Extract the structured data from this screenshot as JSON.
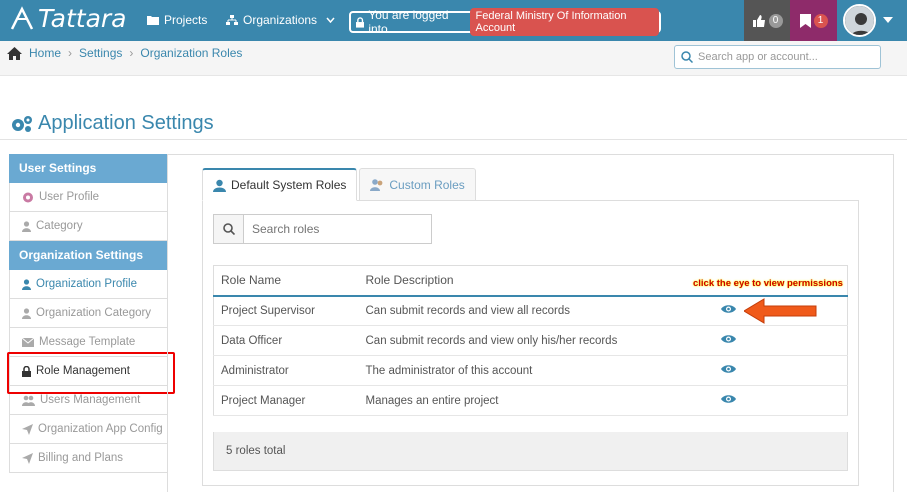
{
  "header": {
    "app_name": "Tattara",
    "nav": {
      "projects": "Projects",
      "organizations": "Organizations"
    },
    "login_prefix": "You are logged into",
    "account_name": "Federal Ministry Of Information Account",
    "likes_count": "0",
    "bookmarks_count": "1"
  },
  "breadcrumb": {
    "home": "Home",
    "settings": "Settings",
    "current": "Organization Roles"
  },
  "search_app": {
    "placeholder": "Search app or account..."
  },
  "page": {
    "title": "Application Settings"
  },
  "sidebar": {
    "user_settings": "User Settings",
    "user_profile": "User Profile",
    "category": "Category",
    "org_settings": "Organization Settings",
    "org_profile": "Organization Profile",
    "org_category": "Organization Category",
    "message_template": "Message Template",
    "role_management": "Role Management",
    "users_management": "Users Management",
    "org_app_config": "Organization App Config",
    "billing": "Billing and Plans"
  },
  "tabs": {
    "default_roles": "Default System Roles",
    "custom_roles": "Custom Roles"
  },
  "roles_search": {
    "placeholder": "Search roles"
  },
  "table": {
    "col_name": "Role Name",
    "col_description": "Role Description",
    "rows": [
      {
        "name": "Project Supervisor",
        "description": "Can submit records and view all records"
      },
      {
        "name": "Data Officer",
        "description": "Can submit records and view only his/her records"
      },
      {
        "name": "Administrator",
        "description": "The administrator of this account"
      },
      {
        "name": "Project Manager",
        "description": "Manages an entire project"
      }
    ],
    "total": "5 roles total"
  },
  "annotation": "click the eye to view permissions",
  "colors": {
    "primary": "#3a87ad",
    "highlight": "#ee0000",
    "arrow": "#f05a1a"
  }
}
